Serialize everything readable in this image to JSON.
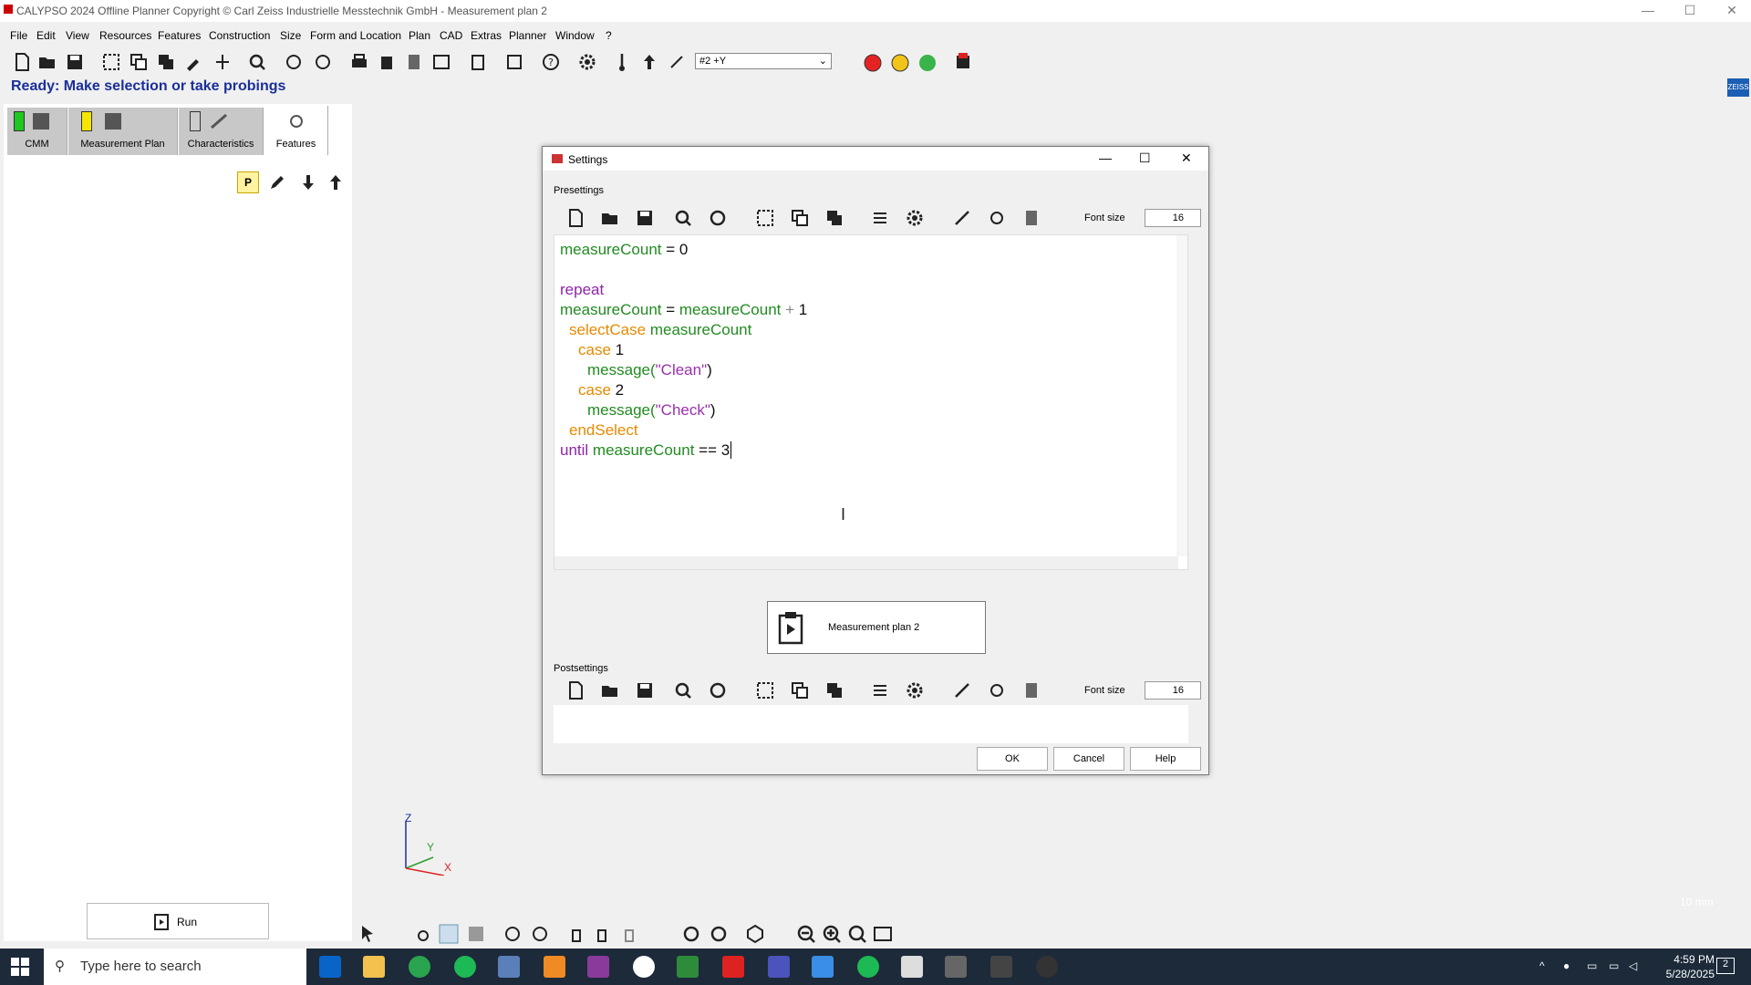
{
  "window": {
    "title": "CALYPSO 2024 Offline Planner Copyright © Carl Zeiss Industrielle Messtechnik GmbH - Measurement plan 2",
    "minimize": "—",
    "maximize": "☐",
    "close": "✕"
  },
  "menu": [
    "File",
    "Edit",
    "View",
    "Resources",
    "Features",
    "Construction",
    "Size",
    "Form and Location",
    "Plan",
    "CAD",
    "Extras",
    "Planner",
    "Window",
    "?"
  ],
  "toolbar": {
    "coord_system": "#2    +Y",
    "status_lights": {
      "red": "#e52323",
      "yellow": "#f2c318",
      "green": "#3ab34a"
    }
  },
  "status_line": "Ready: Make selection or take probings",
  "left_tabs": [
    {
      "label": "CMM",
      "indicator": "#1ec81e"
    },
    {
      "label": "Measurement Plan",
      "indicator": "#f5e600"
    },
    {
      "label": "Characteristics",
      "indicator": ""
    },
    {
      "label": "Features",
      "indicator": ""
    }
  ],
  "left_tools": {
    "p_badge": "P"
  },
  "run_button": "Run",
  "axis": {
    "z": "Z",
    "y": "Y",
    "x": "X"
  },
  "scale_label": "10 mm",
  "dialog": {
    "title": "Settings",
    "presettings_label": "Presettings",
    "postsettings_label": "Postsettings",
    "font_size_label": "Font size",
    "font_size_value": "16",
    "post_font_size_value": "16",
    "code": {
      "line1": {
        "a": "measureCount",
        "b": " = ",
        "c": "0"
      },
      "line3": {
        "a": "repeat"
      },
      "line4": {
        "a": "measureCount",
        "b": " = ",
        "c": "measureCount",
        "d": " + ",
        "e": "1"
      },
      "line5": {
        "a": "selectCase",
        "b": " measureCount"
      },
      "line6": {
        "a": "case",
        "b": " 1"
      },
      "line7": {
        "a": "message(",
        "b": "\"Clean\"",
        "c": ")"
      },
      "line8": {
        "a": "case",
        "b": " 2"
      },
      "line9": {
        "a": "message(",
        "b": "\"Check\"",
        "c": ")"
      },
      "line10": {
        "a": "endSelect"
      },
      "line11": {
        "a": "until",
        "b": " measureCount",
        "c": " == ",
        "d": "3"
      }
    },
    "plan_button": "Measurement plan 2",
    "ok": "OK",
    "cancel": "Cancel",
    "help": "Help"
  },
  "taskbar": {
    "search_placeholder": "Type here to search",
    "time": "4:59 PM",
    "date": "5/28/2025",
    "notification_count": "2"
  }
}
